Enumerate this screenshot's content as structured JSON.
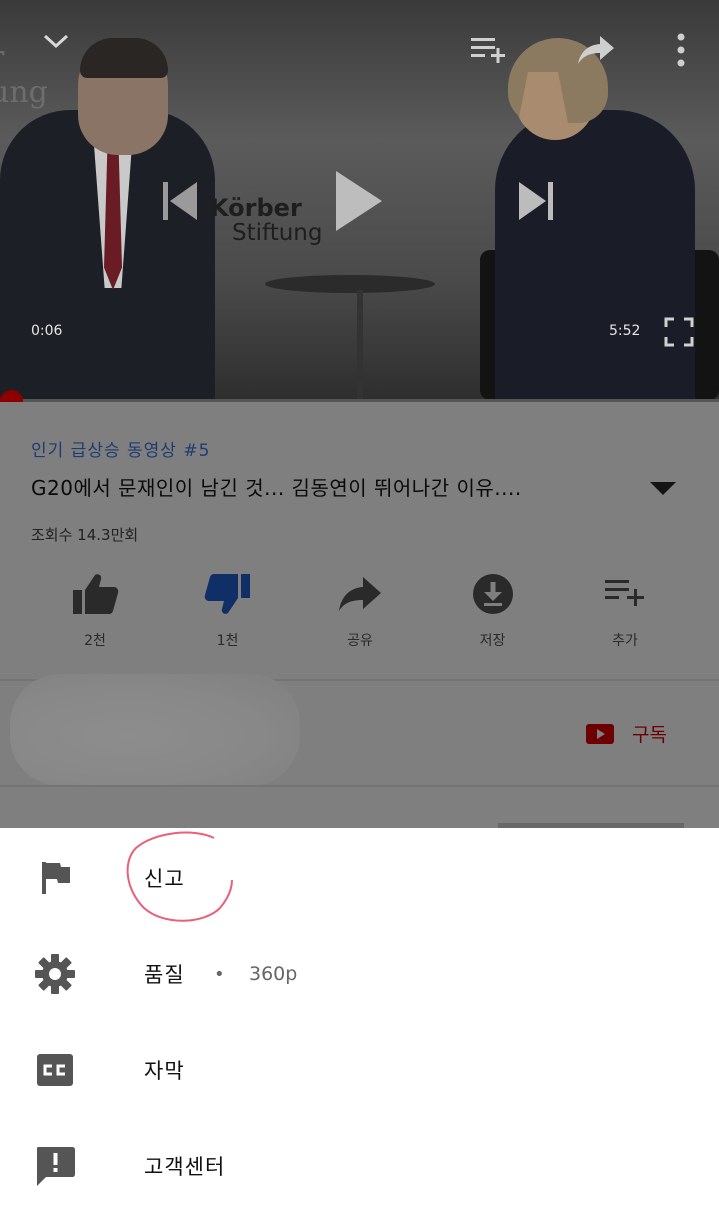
{
  "player": {
    "current_time": "0:06",
    "duration": "5:52",
    "progress": 0.017
  },
  "video": {
    "trending_badge": "인기 급상승 동영상 #5",
    "title": "G20에서 문재인이 남긴 것...  김동연이 뛰어나간 이유....",
    "views": "조회수 14.3만회"
  },
  "actions": [
    {
      "icon": "thumbs-up-icon",
      "label": "2천"
    },
    {
      "icon": "thumbs-down-icon",
      "label": "1천"
    },
    {
      "icon": "share-icon",
      "label": "공유"
    },
    {
      "icon": "download-icon",
      "label": "저장"
    },
    {
      "icon": "playlist-add-icon",
      "label": "추가"
    }
  ],
  "channel": {
    "subscribe_label": "구독"
  },
  "menu": {
    "report_label": "신고",
    "quality_label": "품질",
    "quality_separator": "•",
    "quality_value": "360p",
    "captions_label": "자막",
    "help_label": "고객센터"
  },
  "colors": {
    "accent_red": "#cc0000",
    "overlay_gray": "#7f7f7f",
    "annotation_pink": "#e8607a"
  }
}
